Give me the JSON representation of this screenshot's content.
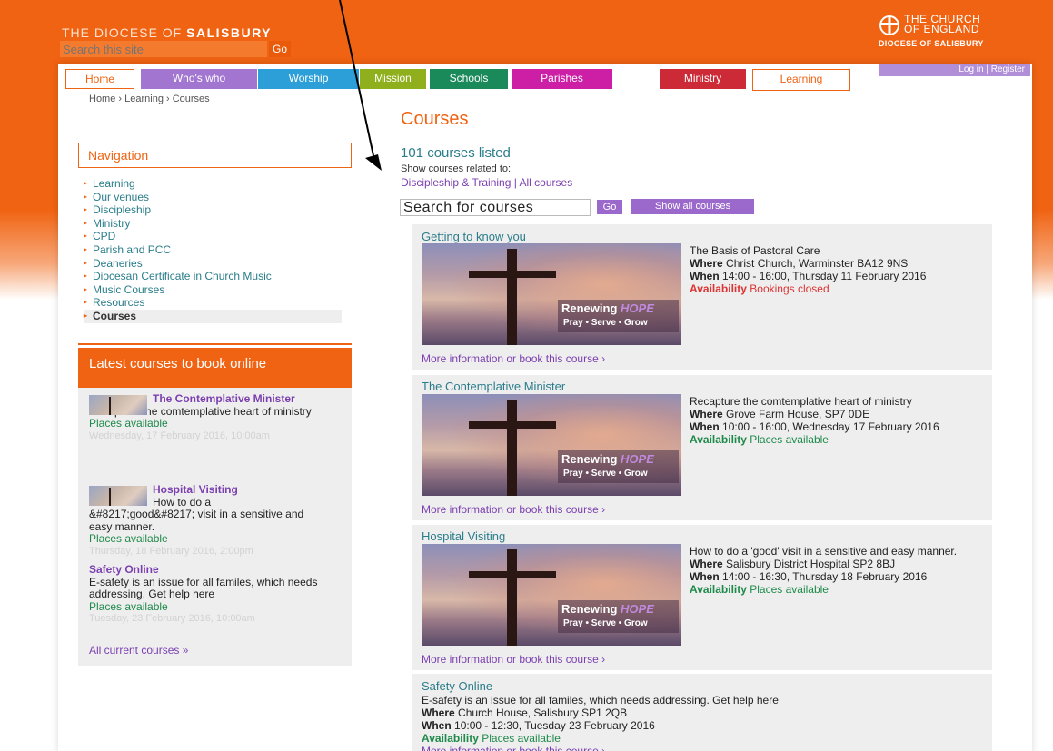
{
  "header": {
    "site_title_prefix": "THE DIOCESE OF",
    "site_title_bold": "SALISBURY",
    "search_placeholder": "Search this site",
    "search_go": "Go",
    "logo_line1": "THE CHURCH",
    "logo_line2": "OF ENGLAND",
    "logo_line3": "DIOCESE OF SALISBURY"
  },
  "account": {
    "login": "Log in",
    "register": "Register"
  },
  "tabs": [
    {
      "label": "Home",
      "color": "#ffffff"
    },
    {
      "label": "Who's who",
      "color": "#a276d0"
    },
    {
      "label": "Worship",
      "color": "#2d9fd8"
    },
    {
      "label": "Mission",
      "color": "#8fb01c"
    },
    {
      "label": "Schools",
      "color": "#1a8a5a"
    },
    {
      "label": "Parishes",
      "color": "#cc1fa6"
    },
    {
      "label": "Ministry",
      "color": "#cc2a36"
    },
    {
      "label": "Learning",
      "color": "#ffffff"
    }
  ],
  "breadcrumb": "Home › Learning › Courses",
  "navigation": {
    "title": "Navigation",
    "items": [
      "Learning",
      "Our venues",
      "Discipleship",
      "Ministry",
      "CPD",
      "Parish and PCC",
      "Deaneries",
      "Diocesan Certificate in Church Music",
      "Music Courses",
      "Resources",
      "Courses"
    ]
  },
  "latest": {
    "title": "Latest courses to book online",
    "items": [
      {
        "title": "The Contemplative Minister",
        "desc": "Recapture the comtemplative heart of ministry",
        "availability": "Places available",
        "date": "Wednesday, 17 February 2016, 10:00am"
      },
      {
        "title": "Hospital Visiting",
        "desc": "How to do a &#8217;good&#8217; visit in a sensitive and easy manner.",
        "availability": "Places available",
        "date": "Thursday, 18 February 2016, 2:00pm"
      },
      {
        "title": "Safety Online",
        "desc": "E-safety is an issue for all familes, which needs addressing. Get help here",
        "availability": "Places available",
        "date": "Tuesday, 23 February 2016, 10:00am"
      }
    ],
    "all_link": "All current courses »"
  },
  "main": {
    "title": "Courses",
    "count": "101 courses listed",
    "related_label": "Show courses related to:",
    "related_links": "Discipleship & Training | All courses",
    "search_value": "Search for courses",
    "go": "Go",
    "show_all": "Show all courses"
  },
  "image_text": {
    "line1_a": "Renewing",
    "line1_b": "HOPE",
    "line2": "Pray • Serve • Grow"
  },
  "labels": {
    "where": "Where",
    "when": "When",
    "availability": "Availability",
    "more": "More information or book this course ›"
  },
  "courses": [
    {
      "title": "Getting to know you",
      "desc": "The Basis of Pastoral Care",
      "where": "Christ Church, Warminster BA12 9NS",
      "when": "14:00 - 16:00, Thursday 11 February 2016",
      "availability": "Bookings closed"
    },
    {
      "title": "The Contemplative Minister",
      "desc": "Recapture the comtemplative heart of ministry",
      "where": "Grove Farm House, SP7 0DE",
      "when": "10:00 - 16:00, Wednesday 17 February 2016",
      "availability": "Places available"
    },
    {
      "title": "Hospital Visiting",
      "desc": "How to do a 'good' visit in a sensitive and easy manner.",
      "where": "Salisbury District Hospital SP2 8BJ",
      "when": "14:00 - 16:30, Thursday 18 February 2016",
      "availability": "Places available"
    },
    {
      "title": "Safety Online",
      "desc": "E-safety is an issue for all familes, which needs addressing. Get help here",
      "where": "Church House, Salisbury SP1 2QB",
      "when": "10:00 - 12:30, Tuesday 23 February 2016",
      "availability": "Places available"
    }
  ],
  "colors": {
    "brand_orange": "#f06312",
    "link_purple": "#7b3fb0",
    "teal": "#2a7d8a",
    "green": "#1e8a4a",
    "closed_red": "#dd3333"
  }
}
